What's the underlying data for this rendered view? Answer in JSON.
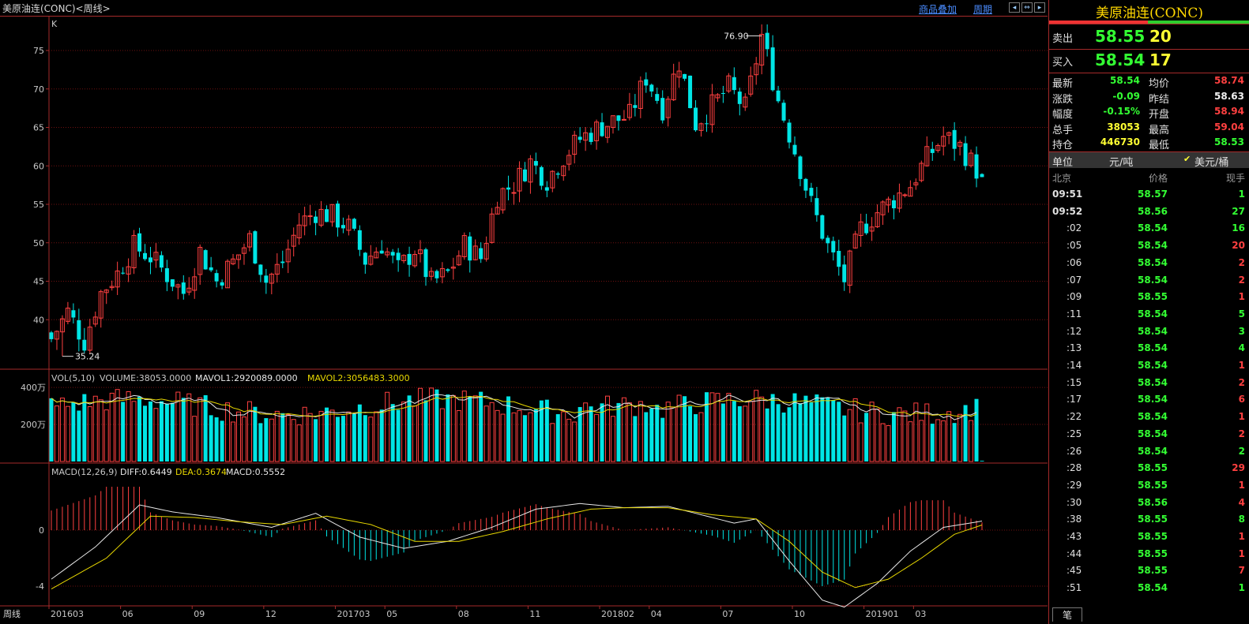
{
  "window": {
    "title": "美原油连(CONC)<周线>"
  },
  "toolbar": {
    "overlay_label": "商品叠加",
    "period_label": "周期"
  },
  "chart": {
    "k_label": "K",
    "price_axis": [
      "75",
      "70",
      "65",
      "60",
      "55",
      "50",
      "45",
      "40"
    ],
    "high_label": "76.90",
    "low_label": "35.24",
    "vol_legend": {
      "name": "VOL(5,10)",
      "volume": "VOLUME:38053.0000",
      "mavol1": "MAVOL1:2920089.0000",
      "mavol2": "MAVOL2:3056483.3000"
    },
    "vol_axis": [
      "400万",
      "200万"
    ],
    "macd_legend": {
      "name": "MACD(12,26,9)",
      "diff": "DIFF:0.6449",
      "dea": "DEA:0.3674",
      "macd": "MACD:0.5552"
    },
    "macd_axis": [
      "0",
      "-4"
    ],
    "period_name": "周线",
    "x_axis": [
      "201603",
      "06",
      "09",
      "12",
      "201703",
      "05",
      "08",
      "11",
      "201802",
      "04",
      "07",
      "10",
      "201901",
      "03"
    ],
    "colors": {
      "up": "#ff4040",
      "down": "#00e5e5",
      "diff": "#e8e8e8",
      "dea": "#e8d800",
      "grid": "#6e1010"
    }
  },
  "chart_data": {
    "type": "candlestick",
    "title": "美原油连(CONC)<周线>",
    "interval": "weekly",
    "x_range": [
      "201603",
      "201904"
    ],
    "y_range": [
      34,
      79
    ],
    "high": 76.9,
    "low": 35.24,
    "close_path": [
      [
        0,
        37.5
      ],
      [
        3,
        41
      ],
      [
        6,
        37.2
      ],
      [
        9,
        43.5
      ],
      [
        12,
        46
      ],
      [
        15,
        49.5
      ],
      [
        18,
        48.2
      ],
      [
        21,
        45.8
      ],
      [
        24,
        43.5
      ],
      [
        27,
        48.9
      ],
      [
        30,
        45
      ],
      [
        33,
        47.5
      ],
      [
        36,
        50.5
      ],
      [
        39,
        45
      ],
      [
        42,
        47.5
      ],
      [
        45,
        52.5
      ],
      [
        48,
        54
      ],
      [
        51,
        53.5
      ],
      [
        54,
        52
      ],
      [
        57,
        47.7
      ],
      [
        60,
        49.8
      ],
      [
        63,
        46.5
      ],
      [
        66,
        49.2
      ],
      [
        69,
        44.8
      ],
      [
        72,
        46
      ],
      [
        75,
        49.7
      ],
      [
        78,
        48
      ],
      [
        81,
        56.2
      ],
      [
        84,
        57.6
      ],
      [
        87,
        60.5
      ],
      [
        90,
        58.2
      ],
      [
        93,
        61.2
      ],
      [
        96,
        63.5
      ],
      [
        99,
        64.8
      ],
      [
        102,
        65.8
      ],
      [
        105,
        66.5
      ],
      [
        108,
        71.5
      ],
      [
        111,
        67.5
      ],
      [
        114,
        73.5
      ],
      [
        117,
        65.5
      ],
      [
        120,
        67.8
      ],
      [
        123,
        70.2
      ],
      [
        126,
        67.5
      ],
      [
        129,
        76.9
      ],
      [
        132,
        68.5
      ],
      [
        135,
        62
      ],
      [
        138,
        55
      ],
      [
        141,
        49.5
      ],
      [
        144,
        45.2
      ],
      [
        147,
        51.8
      ],
      [
        150,
        54
      ],
      [
        153,
        55.7
      ],
      [
        156,
        57.5
      ],
      [
        159,
        61
      ],
      [
        162,
        63.8
      ],
      [
        165,
        62.5
      ],
      [
        168,
        59.5
      ],
      [
        169,
        58.54
      ]
    ],
    "volume_recent": 38053,
    "mavol1": 2920089.0,
    "mavol2": 3056483.3,
    "volume_unit": "万",
    "volume_axis": [
      0,
      400
    ],
    "diff_path": [
      [
        0,
        -3.5
      ],
      [
        8,
        -1.2
      ],
      [
        16,
        1.8
      ],
      [
        22,
        1.3
      ],
      [
        30,
        0.9
      ],
      [
        40,
        0.2
      ],
      [
        48,
        1.2
      ],
      [
        56,
        -0.5
      ],
      [
        64,
        -1.3
      ],
      [
        72,
        -0.8
      ],
      [
        80,
        0.2
      ],
      [
        88,
        1.5
      ],
      [
        96,
        1.9
      ],
      [
        104,
        1.6
      ],
      [
        112,
        1.7
      ],
      [
        118,
        1.1
      ],
      [
        124,
        0.5
      ],
      [
        128,
        0.8
      ],
      [
        134,
        -2.2
      ],
      [
        140,
        -5
      ],
      [
        144,
        -5.5
      ],
      [
        150,
        -3.8
      ],
      [
        156,
        -1.5
      ],
      [
        162,
        0.2
      ],
      [
        166,
        0.45
      ],
      [
        169,
        0.6449
      ]
    ],
    "dea_path": [
      [
        0,
        -4.2
      ],
      [
        10,
        -2
      ],
      [
        18,
        1
      ],
      [
        26,
        0.9
      ],
      [
        34,
        0.6
      ],
      [
        42,
        0.4
      ],
      [
        50,
        1
      ],
      [
        58,
        0.4
      ],
      [
        66,
        -0.8
      ],
      [
        74,
        -0.8
      ],
      [
        82,
        -0.1
      ],
      [
        90,
        0.8
      ],
      [
        98,
        1.5
      ],
      [
        104,
        1.6
      ],
      [
        112,
        1.6
      ],
      [
        120,
        1.1
      ],
      [
        128,
        0.8
      ],
      [
        134,
        -0.8
      ],
      [
        140,
        -3
      ],
      [
        146,
        -4.1
      ],
      [
        152,
        -3.5
      ],
      [
        158,
        -2
      ],
      [
        164,
        -0.3
      ],
      [
        169,
        0.3674
      ]
    ],
    "diff": 0.6449,
    "dea": 0.3674,
    "macd": 0.5552,
    "macd_axis": [
      -4,
      0
    ]
  },
  "quote": {
    "title": "美原油连(CONC)",
    "sell_label": "卖出",
    "sell_price": "58.55",
    "sell_qty": "20",
    "buy_label": "买入",
    "buy_price": "58.54",
    "buy_qty": "17",
    "stats": [
      {
        "l1": "最新",
        "v1": "58.54",
        "c1": "green",
        "l2": "均价",
        "v2": "58.74",
        "c2": "red"
      },
      {
        "l1": "涨跌",
        "v1": "-0.09",
        "c1": "green",
        "l2": "昨结",
        "v2": "58.63",
        "c2": "white"
      },
      {
        "l1": "幅度",
        "v1": "-0.15%",
        "c1": "green",
        "l2": "开盘",
        "v2": "58.94",
        "c2": "red"
      },
      {
        "l1": "总手",
        "v1": "38053",
        "c1": "yellow",
        "l2": "最高",
        "v2": "59.04",
        "c2": "red"
      },
      {
        "l1": "持仓",
        "v1": "446730",
        "c1": "yellow",
        "l2": "最低",
        "v2": "58.53",
        "c2": "green"
      }
    ],
    "unit_label": "单位",
    "unit_value": "元/吨",
    "unit_alt": "美元/桶",
    "tick_header": {
      "time": "北京",
      "price": "价格",
      "qty": "现手"
    },
    "ticks": [
      {
        "t": "09:51",
        "p": "58.57",
        "q": "1",
        "qc": "green",
        "bold": true
      },
      {
        "t": "09:52",
        "p": "58.56",
        "q": "27",
        "qc": "green",
        "bold": true
      },
      {
        "t": ":02",
        "p": "58.54",
        "q": "16",
        "qc": "green"
      },
      {
        "t": ":05",
        "p": "58.54",
        "q": "20",
        "qc": "red"
      },
      {
        "t": ":06",
        "p": "58.54",
        "q": "2",
        "qc": "red"
      },
      {
        "t": ":07",
        "p": "58.54",
        "q": "2",
        "qc": "red"
      },
      {
        "t": ":09",
        "p": "58.55",
        "q": "1",
        "qc": "red"
      },
      {
        "t": ":11",
        "p": "58.54",
        "q": "5",
        "qc": "green"
      },
      {
        "t": ":12",
        "p": "58.54",
        "q": "3",
        "qc": "green"
      },
      {
        "t": ":13",
        "p": "58.54",
        "q": "4",
        "qc": "green"
      },
      {
        "t": ":14",
        "p": "58.54",
        "q": "1",
        "qc": "red"
      },
      {
        "t": ":15",
        "p": "58.54",
        "q": "2",
        "qc": "red"
      },
      {
        "t": ":17",
        "p": "58.54",
        "q": "6",
        "qc": "red"
      },
      {
        "t": ":22",
        "p": "58.54",
        "q": "1",
        "qc": "red"
      },
      {
        "t": ":25",
        "p": "58.54",
        "q": "2",
        "qc": "red"
      },
      {
        "t": ":26",
        "p": "58.54",
        "q": "2",
        "qc": "green"
      },
      {
        "t": ":28",
        "p": "58.55",
        "q": "29",
        "qc": "red"
      },
      {
        "t": ":29",
        "p": "58.55",
        "q": "1",
        "qc": "red"
      },
      {
        "t": ":30",
        "p": "58.56",
        "q": "4",
        "qc": "red"
      },
      {
        "t": ":38",
        "p": "58.55",
        "q": "8",
        "qc": "green"
      },
      {
        "t": ":43",
        "p": "58.55",
        "q": "1",
        "qc": "red"
      },
      {
        "t": ":44",
        "p": "58.55",
        "q": "1",
        "qc": "red"
      },
      {
        "t": ":45",
        "p": "58.55",
        "q": "7",
        "qc": "red"
      },
      {
        "t": ":51",
        "p": "58.54",
        "q": "1",
        "qc": "green"
      }
    ],
    "bottom_tab": "笔"
  }
}
